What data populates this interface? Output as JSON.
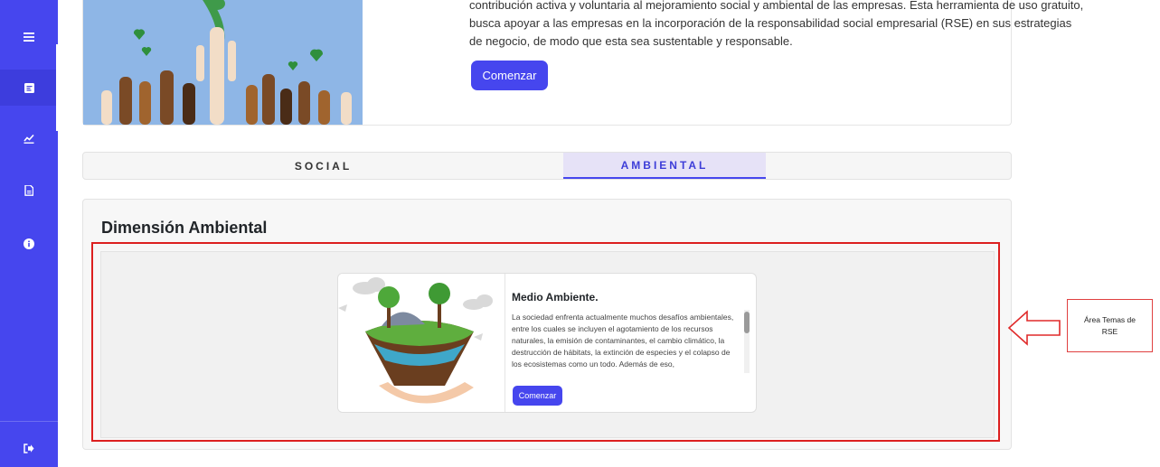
{
  "sidebar": {
    "items": [
      {
        "icon": "menu-icon"
      },
      {
        "icon": "form-icon",
        "active": true
      },
      {
        "icon": "chart-icon"
      },
      {
        "icon": "document-icon"
      },
      {
        "icon": "info-icon"
      }
    ],
    "logout_icon": "logout-icon"
  },
  "intro": {
    "text": "contribución activa y voluntaria al mejoramiento social y ambiental de las empresas. Esta herramienta de uso gratuito, busca apoyar a las empresas en la incorporación de la responsabilidad social empresarial (RSE) en sus estrategias de negocio, de modo que esta sea sustentable y responsable.",
    "button_label": "Comenzar"
  },
  "tabs": [
    {
      "label": "SOCIAL",
      "active": false
    },
    {
      "label": "AMBIENTAL",
      "active": true
    }
  ],
  "dimension": {
    "title": "Dimensión Ambiental",
    "topic": {
      "title": "Medio Ambiente.",
      "description": "La sociedad enfrenta actualmente muchos desafíos ambientales, entre los cuales se incluyen el agotamiento de los recursos naturales, la emisión de contaminantes, el cambio climático, la destrucción de hábitats, la extinción de especies y el colapso de los ecosistemas como un todo. Además de eso,",
      "button_label": "Comenzar"
    }
  },
  "annotation": {
    "label": "Área Temas de RSE"
  },
  "colors": {
    "primary": "#4646ee",
    "highlight_red": "#dc1f1f",
    "active_tab_bg": "#e6e2f7"
  }
}
